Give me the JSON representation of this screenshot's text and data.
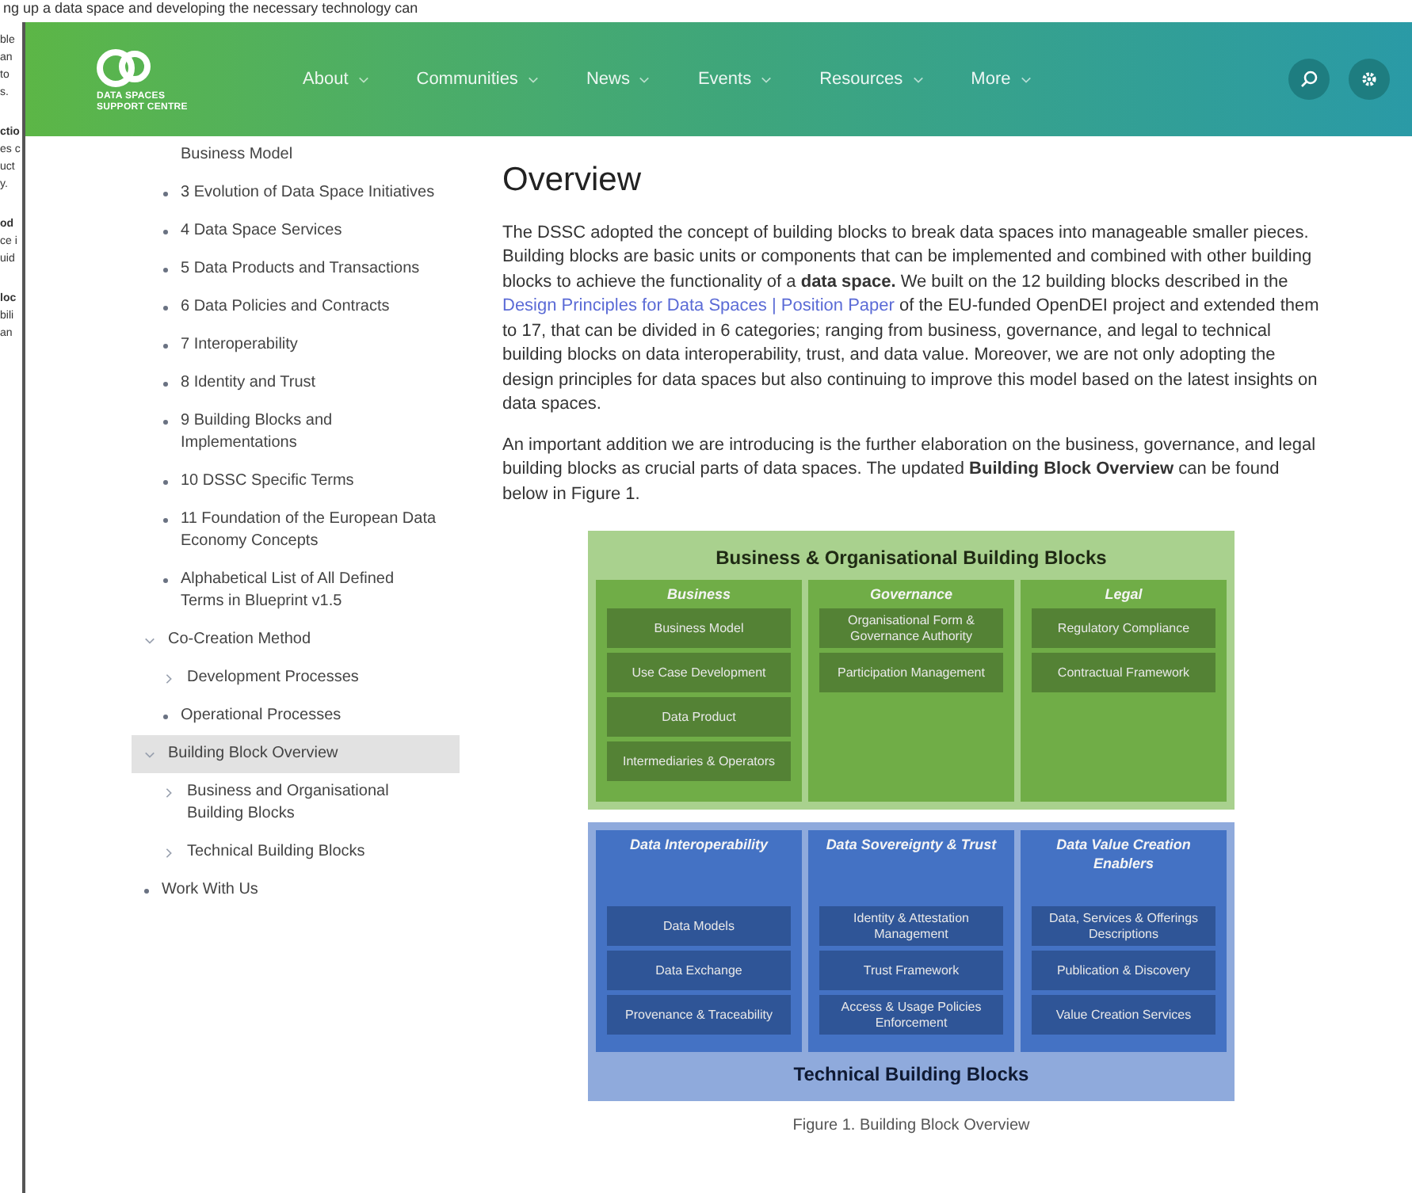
{
  "background_document": {
    "top_line": "ng up a data space and developing the necessary technology can",
    "fragments": [
      {
        "text": "ble",
        "bold": false
      },
      {
        "text": "an",
        "bold": false
      },
      {
        "text": "to",
        "bold": false
      },
      {
        "text": "s.",
        "bold": false
      },
      {
        "text": "ctio",
        "bold": true
      },
      {
        "text": "es c",
        "bold": false
      },
      {
        "text": "uct",
        "bold": false
      },
      {
        "text": "y.",
        "bold": false
      },
      {
        "text": "od",
        "bold": true
      },
      {
        "text": "ce i",
        "bold": false
      },
      {
        "text": "uid",
        "bold": false
      },
      {
        "text": "loc",
        "bold": true
      },
      {
        "text": "bili",
        "bold": false
      },
      {
        "text": "an",
        "bold": false
      }
    ]
  },
  "header": {
    "logo_lines": [
      "DATA SPACES",
      "SUPPORT CENTRE"
    ],
    "nav": [
      {
        "label": "About"
      },
      {
        "label": "Communities"
      },
      {
        "label": "News"
      },
      {
        "label": "Events"
      },
      {
        "label": "Resources"
      },
      {
        "label": "More"
      }
    ]
  },
  "sidebar": {
    "continued_items": [
      {
        "label": "Business Model",
        "kind": "continued",
        "selected": false
      },
      {
        "label": "3 Evolution of Data Space Initiatives",
        "kind": "bullet",
        "selected": false
      },
      {
        "label": "4 Data Space Services",
        "kind": "bullet",
        "selected": false
      },
      {
        "label": "5 Data Products and Transactions",
        "kind": "bullet",
        "selected": false
      },
      {
        "label": "6 Data Policies and Contracts",
        "kind": "bullet",
        "selected": false
      },
      {
        "label": "7 Interoperability",
        "kind": "bullet",
        "selected": false
      },
      {
        "label": "8 Identity and Trust",
        "kind": "bullet",
        "selected": false
      },
      {
        "label": "9 Building Blocks and Implementations",
        "kind": "bullet",
        "selected": false
      },
      {
        "label": "10 DSSC Specific Terms",
        "kind": "bullet",
        "selected": false
      },
      {
        "label": "11 Foundation of the European Data Economy Concepts",
        "kind": "bullet",
        "selected": false
      },
      {
        "label": "Alphabetical List of All Defined Terms in Blueprint v1.5",
        "kind": "bullet",
        "selected": false
      }
    ],
    "items": [
      {
        "label": "Co-Creation Method",
        "kind": "folder",
        "expanded": true,
        "selected": false,
        "children": [
          {
            "label": "Development Processes",
            "kind": "folder",
            "expanded": false,
            "selected": false
          },
          {
            "label": "Operational Processes",
            "kind": "bullet",
            "selected": false
          }
        ]
      },
      {
        "label": "Building Block Overview",
        "kind": "folder",
        "expanded": true,
        "selected": true,
        "children": [
          {
            "label": "Business and Organisational Building Blocks",
            "kind": "folder",
            "expanded": false,
            "selected": false
          },
          {
            "label": "Technical Building Blocks",
            "kind": "folder",
            "expanded": false,
            "selected": false
          }
        ]
      },
      {
        "label": "Work With Us",
        "kind": "bullet",
        "selected": false
      }
    ]
  },
  "main": {
    "title": "Overview",
    "paragraphs": [
      [
        {
          "kind": "text",
          "text": "The DSSC adopted the concept of building blocks to break data spaces into manageable smaller pieces. Building blocks are basic units or components that can be implemented and combined with other building blocks to achieve the functionality of a **data space.** We built on the 12 building blocks described in the "
        },
        {
          "kind": "link",
          "text": "Design Principles for Data Spaces | Position Paper"
        },
        {
          "kind": "text",
          "text": " of the EU-funded OpenDEI project and extended them to 17, that can be divided in 6 categories; ranging from business, governance, and legal to technical building blocks on data interoperability, trust, and data value. Moreover, we are not only adopting the design principles for data spaces but also continuing to improve this model based on the latest insights on data spaces."
        }
      ],
      [
        {
          "kind": "text",
          "text": "An important addition we are introducing is the further elaboration on the business, governance, and legal building blocks as crucial parts of data spaces. The updated **Building Block Overview** can be found below in Figure 1."
        }
      ]
    ],
    "figure": {
      "groups": [
        {
          "kind": "business",
          "title": "Business & Organisational Building Blocks",
          "columns": [
            {
              "heading": "Business",
              "items": [
                "Business Model",
                "Use Case Development",
                "Data Product",
                "Intermediaries & Operators"
              ]
            },
            {
              "heading": "Governance",
              "items": [
                "Organisational Form & Governance Authority",
                "Participation Management"
              ]
            },
            {
              "heading": "Legal",
              "items": [
                "Regulatory Compliance",
                "Contractual Framework"
              ]
            }
          ]
        },
        {
          "kind": "technical",
          "title": "Technical Building Blocks",
          "columns": [
            {
              "heading": "Data Interoperability",
              "items": [
                "Data Models",
                "Data Exchange",
                "Provenance & Traceability"
              ]
            },
            {
              "heading": "Data Sovereignty & Trust",
              "items": [
                "Identity & Attestation Management",
                "Trust Framework",
                "Access & Usage Policies Enforcement"
              ]
            },
            {
              "heading": "Data Value Creation Enablers",
              "items": [
                "Data, Services & Offerings Descriptions",
                "Publication & Discovery",
                "Value Creation Services"
              ]
            }
          ]
        }
      ],
      "caption": "Figure 1. Building Block Overview"
    }
  }
}
